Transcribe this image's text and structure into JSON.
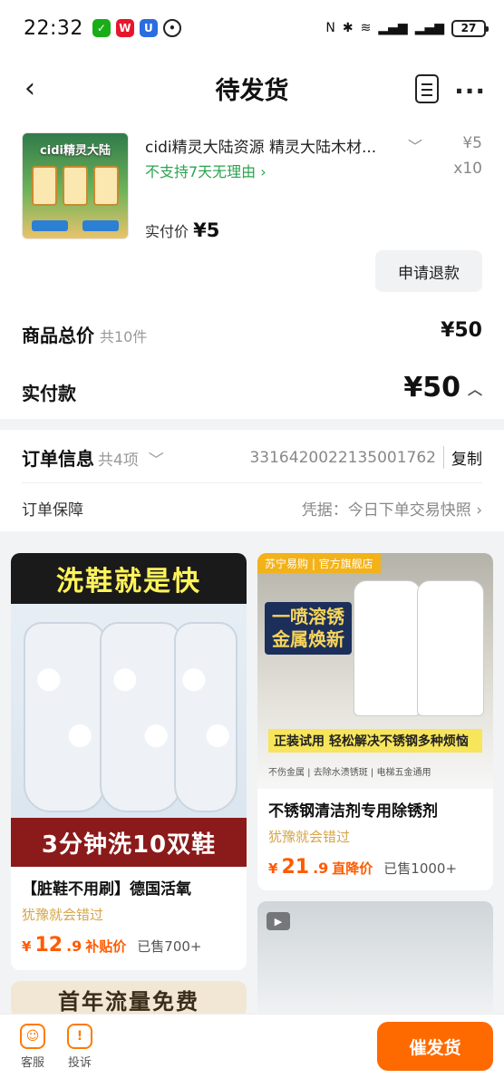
{
  "status_bar": {
    "time": "22:32",
    "battery": "27"
  },
  "nav": {
    "title": "待发货"
  },
  "order": {
    "product_title": "cidi精灵大陆资源 精灵大陆木材...",
    "thumb_title": "cidi精灵大陆",
    "price": "¥5",
    "policy": "不支持7天无理由",
    "quantity": "x10",
    "paid_label": "实付价",
    "paid_value": "¥5",
    "refund_button": "申请退款",
    "total_label": "商品总价",
    "total_count": "共10件",
    "total_value": "¥50",
    "actual_label": "实付款",
    "actual_value": "¥50"
  },
  "info": {
    "order_label": "订单信息",
    "order_sub": "共4项",
    "order_no": "3316420022135001762",
    "copy_label": "复制",
    "guarantee_label": "订单保障",
    "guarantee_value": "凭据：今日下单交易快照"
  },
  "feed": [
    {
      "banner_top": "洗鞋就是快",
      "banner_bottom": "3分钟洗10双鞋",
      "title": "【脏鞋不用刷】德国活氧",
      "tag": "犹豫就会错过",
      "price_int": "12",
      "price_dec": ".9",
      "price_label": "补贴价",
      "sold": "已售700+"
    },
    {
      "brand": "苏宁易购 | 官方旗舰店",
      "headline_1": "一喷溶锈",
      "headline_2": "金属焕新",
      "strip": "正装试用 轻松解决不锈钢多种烦恼",
      "footer": "不伤金属 | 去除水渍锈斑 | 电梯五金通用",
      "title": "不锈钢清洁剂专用除锈剂",
      "tag": "犹豫就会错过",
      "price_int": "21",
      "price_dec": ".9",
      "price_label": "直降价",
      "sold": "已售1000+"
    },
    {
      "banner": "首年流量免费"
    }
  ],
  "bottom": {
    "service": "客服",
    "complain": "投诉",
    "urge": "催发货"
  },
  "colors": {
    "accent": "#ff6a00",
    "green": "#2aa44f",
    "tag": "#d6a64a"
  }
}
